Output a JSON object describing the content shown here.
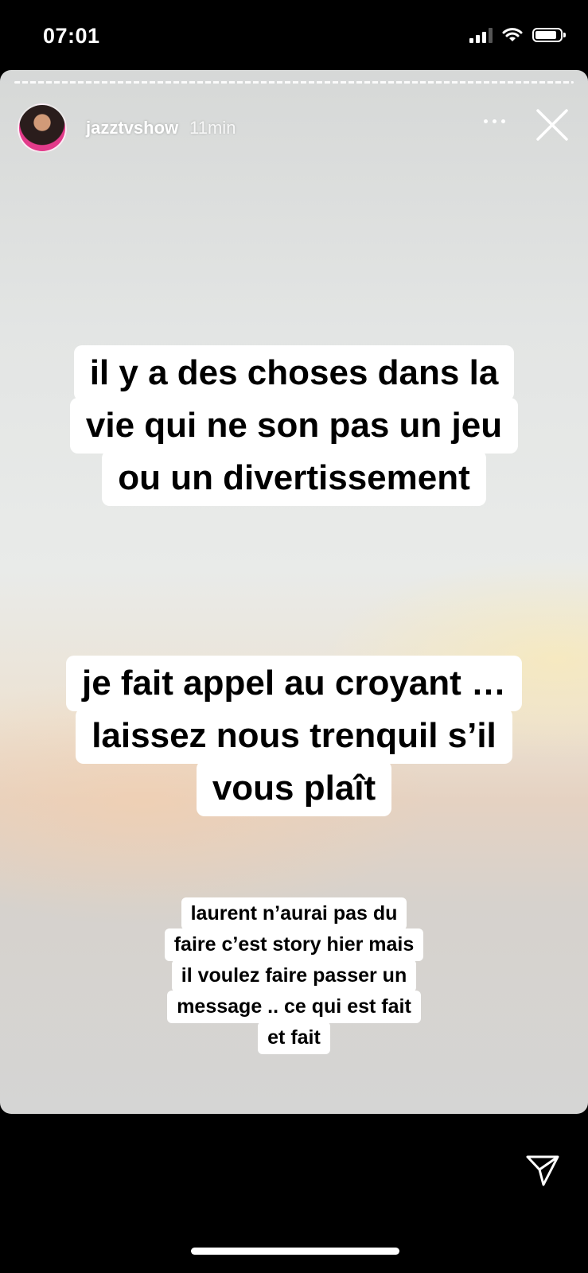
{
  "status_bar": {
    "time": "07:01"
  },
  "story": {
    "username": "jazztvshow",
    "time_ago": "11min",
    "captions": [
      {
        "lines": [
          "il y a des choses dans la",
          "vie qui ne son pas un jeu",
          "ou un divertissement"
        ]
      },
      {
        "lines": [
          "je fait appel au croyant …",
          "laissez nous trenquil s’il",
          "vous plaît"
        ]
      },
      {
        "lines": [
          "laurent n’aurai pas du",
          "faire c’est story hier mais",
          "il voulez faire passer un",
          "message .. ce qui est fait",
          "et fait"
        ]
      }
    ]
  },
  "icons": {
    "signal": "signal-icon",
    "wifi": "wifi-icon",
    "battery": "battery-icon",
    "more": "more-icon",
    "close": "close-icon",
    "send": "send-icon"
  }
}
